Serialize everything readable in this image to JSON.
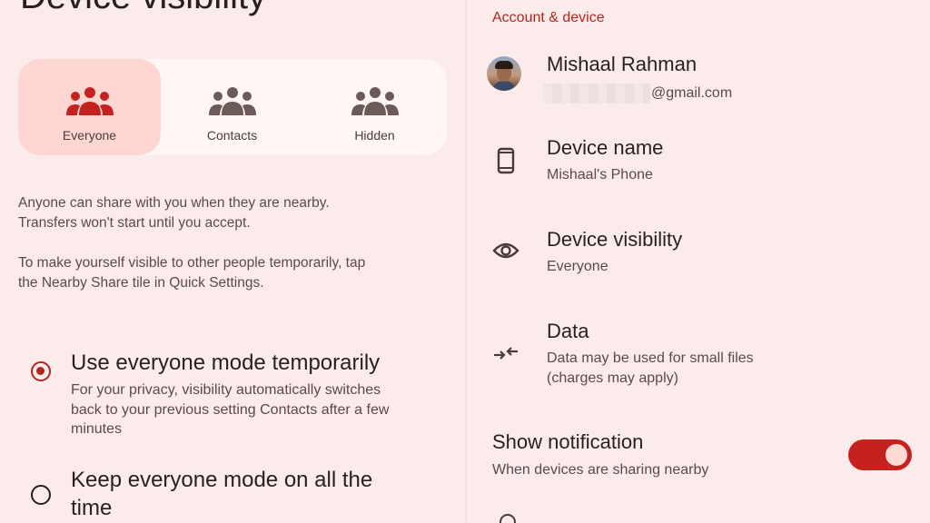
{
  "left": {
    "page_title": "Device visibility",
    "segments": [
      {
        "label": "Everyone",
        "icon": "group-icon",
        "selected": true
      },
      {
        "label": "Contacts",
        "icon": "group-icon",
        "selected": false
      },
      {
        "label": "Hidden",
        "icon": "group-icon",
        "selected": false
      }
    ],
    "description_1_line1": "Anyone can share with you when they are nearby.",
    "description_1_line2": "Transfers won't start until you accept.",
    "description_2_line1": "To make yourself visible to other people temporarily, tap",
    "description_2_line2": "the Nearby Share tile in Quick Settings.",
    "options": [
      {
        "title": "Use everyone mode temporarily",
        "sub_line1": "For your privacy, visibility automatically switches",
        "sub_line2": "back to your previous setting Contacts after a few",
        "sub_line3": "minutes",
        "selected": true
      },
      {
        "title_line1": "Keep everyone mode on all the",
        "title_line2": "time",
        "selected": false
      }
    ]
  },
  "right": {
    "section_header": "Account & device",
    "account": {
      "name": "Mishaal Rahman",
      "email_suffix": "@gmail.com"
    },
    "device_name": {
      "title": "Device name",
      "value": "Mishaal's Phone",
      "icon": "phone-icon"
    },
    "device_visibility": {
      "title": "Device visibility",
      "value": "Everyone",
      "icon": "eye-icon"
    },
    "data": {
      "title": "Data",
      "value_line1": "Data may be used for small files",
      "value_line2": "(charges may apply)",
      "icon": "data-arrows-icon"
    },
    "show_notification": {
      "title": "Show notification",
      "value": "When devices are sharing nearby",
      "toggle_on": true
    }
  },
  "colors": {
    "accent": "#b3261e",
    "background": "#fbeceb",
    "selected_segment": "#ffd7d2"
  }
}
